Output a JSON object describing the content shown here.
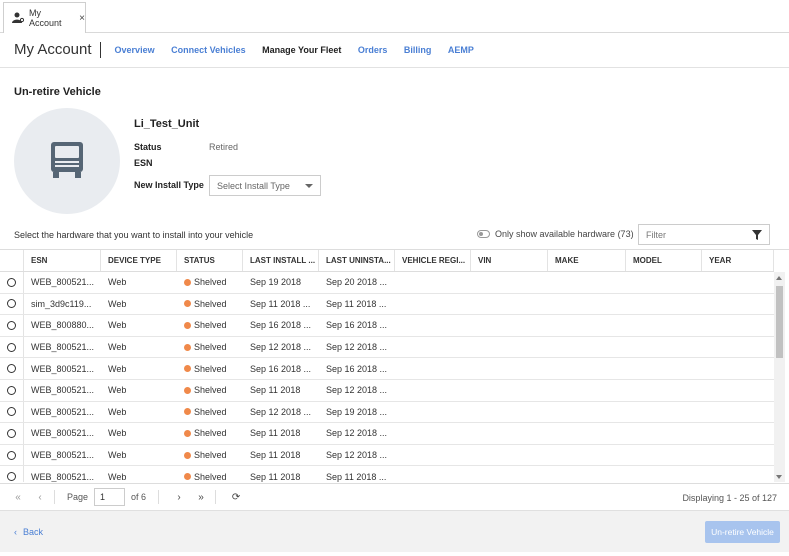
{
  "tab": {
    "label": "My Account",
    "close": "×"
  },
  "header": {
    "brand": "My Account",
    "nav": [
      "Overview",
      "Connect Vehicles",
      "Manage Your Fleet",
      "Orders",
      "Billing",
      "AEMP"
    ],
    "active_nav": "Manage Your Fleet"
  },
  "page": {
    "title": "Un-retire Vehicle",
    "vehicle_name": "Li_Test_Unit",
    "status_label": "Status",
    "status_value": "Retired",
    "esn_label": "ESN",
    "install_type_label": "New Install Type",
    "install_type_placeholder": "Select Install Type",
    "hint": "Select the hardware that you want to install into your vehicle",
    "toggle_label": "Only show available hardware (73)",
    "filter_placeholder": "Filter"
  },
  "table": {
    "columns": [
      "ESN",
      "DEVICE TYPE",
      "STATUS",
      "LAST INSTALL ...",
      "LAST UNINSTA...",
      "VEHICLE REGI...",
      "VIN",
      "MAKE",
      "MODEL",
      "YEAR"
    ],
    "rows": [
      [
        "WEB_800521...",
        "Web",
        "Shelved",
        "Sep 19 2018",
        "Sep 20 2018 ..."
      ],
      [
        "sim_3d9c119...",
        "Web",
        "Shelved",
        "Sep 11 2018 ...",
        "Sep 11 2018 ..."
      ],
      [
        "WEB_800880...",
        "Web",
        "Shelved",
        "Sep 16 2018 ...",
        "Sep 16 2018 ..."
      ],
      [
        "WEB_800521...",
        "Web",
        "Shelved",
        "Sep 12 2018 ...",
        "Sep 12 2018 ..."
      ],
      [
        "WEB_800521...",
        "Web",
        "Shelved",
        "Sep 16 2018 ...",
        "Sep 16 2018 ..."
      ],
      [
        "WEB_800521...",
        "Web",
        "Shelved",
        "Sep 11 2018",
        "Sep 12 2018 ..."
      ],
      [
        "WEB_800521...",
        "Web",
        "Shelved",
        "Sep 12 2018 ...",
        "Sep 19 2018 ..."
      ],
      [
        "WEB_800521...",
        "Web",
        "Shelved",
        "Sep 11 2018",
        "Sep 12 2018 ..."
      ],
      [
        "WEB_800521...",
        "Web",
        "Shelved",
        "Sep 11 2018",
        "Sep 12 2018 ..."
      ],
      [
        "WEB_800521...",
        "Web",
        "Shelved",
        "Sep 11 2018",
        "Sep 11 2018 ..."
      ]
    ]
  },
  "pager": {
    "page_label": "Page",
    "page_value": "1",
    "of_label": "of 6",
    "info": "Displaying 1 - 25 of 127"
  },
  "footer": {
    "back_label": "Back",
    "unretire_label": "Un-retire Vehicle"
  },
  "colors": {
    "accent": "#4a7fd4",
    "shelved": "#f0894a",
    "disabled_button": "#a8c4ee"
  }
}
